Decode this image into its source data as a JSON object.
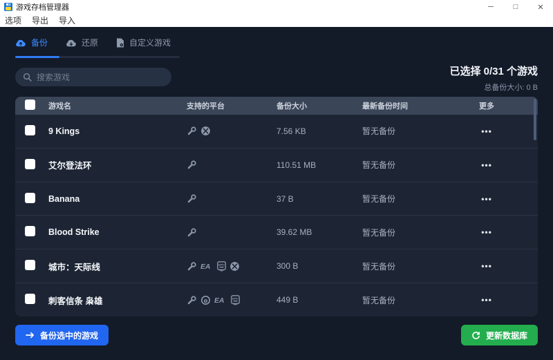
{
  "window": {
    "title": "游戏存档管理器",
    "controls": [
      {
        "name": "minimize",
        "glyph": "─"
      },
      {
        "name": "maximize",
        "glyph": "□"
      },
      {
        "name": "close",
        "glyph": "✕"
      }
    ]
  },
  "menu": {
    "items": [
      "选项",
      "导出",
      "导入"
    ]
  },
  "tabs": [
    {
      "label": "备份",
      "icon": "cloud-upload-icon",
      "active": true
    },
    {
      "label": "还原",
      "icon": "cloud-download-icon",
      "active": false
    },
    {
      "label": "自定义游戏",
      "icon": "custom-game-file-icon",
      "active": false
    }
  ],
  "search": {
    "placeholder": "搜索游戏",
    "value": ""
  },
  "summary": {
    "selected": "已选择 0/31 个游戏",
    "total_size": "总备份大小: 0 B"
  },
  "table": {
    "headers": {
      "name": "游戏名",
      "platforms": "支持的平台",
      "size": "备份大小",
      "latest": "最新备份时间",
      "more": "更多"
    },
    "more_glyph": "•••",
    "rows": [
      {
        "name": "9 Kings",
        "platforms": [
          "steam",
          "xbox"
        ],
        "size": "7.56 KB",
        "latest": "暂无备份"
      },
      {
        "name": "艾尔登法环",
        "platforms": [
          "steam"
        ],
        "size": "110.51 MB",
        "latest": "暂无备份"
      },
      {
        "name": "Banana",
        "platforms": [
          "steam"
        ],
        "size": "37 B",
        "latest": "暂无备份"
      },
      {
        "name": "Blood Strike",
        "platforms": [
          "steam"
        ],
        "size": "39.62 MB",
        "latest": "暂无备份"
      },
      {
        "name": "城市：天际线",
        "platforms": [
          "steam",
          "ea",
          "epic",
          "xbox"
        ],
        "size": "300 B",
        "latest": "暂无备份"
      },
      {
        "name": "刺客信条 枭雄",
        "platforms": [
          "steam",
          "ubisoft",
          "ea",
          "epic"
        ],
        "size": "449 B",
        "latest": "暂无备份"
      }
    ]
  },
  "footer": {
    "backup_label": "备份选中的游戏",
    "update_label": "更新数据库"
  },
  "colors": {
    "accent_blue": "#2166f0",
    "accent_green": "#23ad4e",
    "tab_active": "#3d8bfd",
    "background": "#131a28",
    "table_bg": "#1d2534",
    "table_header_bg": "#3a4557"
  }
}
